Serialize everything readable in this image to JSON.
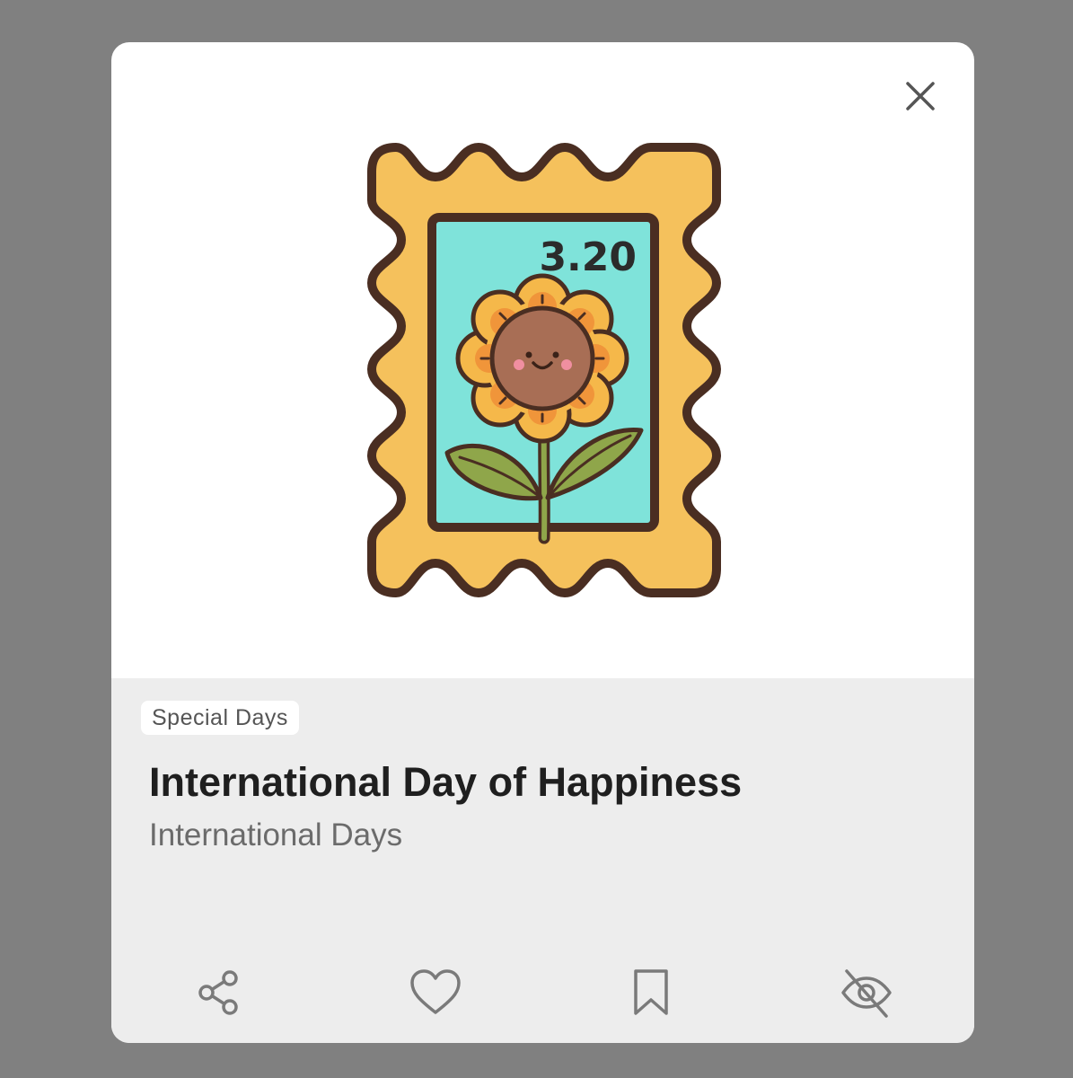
{
  "card": {
    "stamp_label": "3.20",
    "category_tag": "Special Days",
    "title": "International Day of Happiness",
    "subtitle": "International Days"
  },
  "icons": {
    "close": "close-icon",
    "share": "share-icon",
    "like": "heart-icon",
    "save": "bookmark-icon",
    "hide": "eye-off-icon"
  },
  "colors": {
    "backdrop": "#808080",
    "card": "#ffffff",
    "info_panel": "#ededed",
    "stamp_frame": "#f5c15c",
    "stamp_inner": "#7fe3da",
    "outline": "#4a2e22",
    "icon": "#7a7a7a"
  }
}
